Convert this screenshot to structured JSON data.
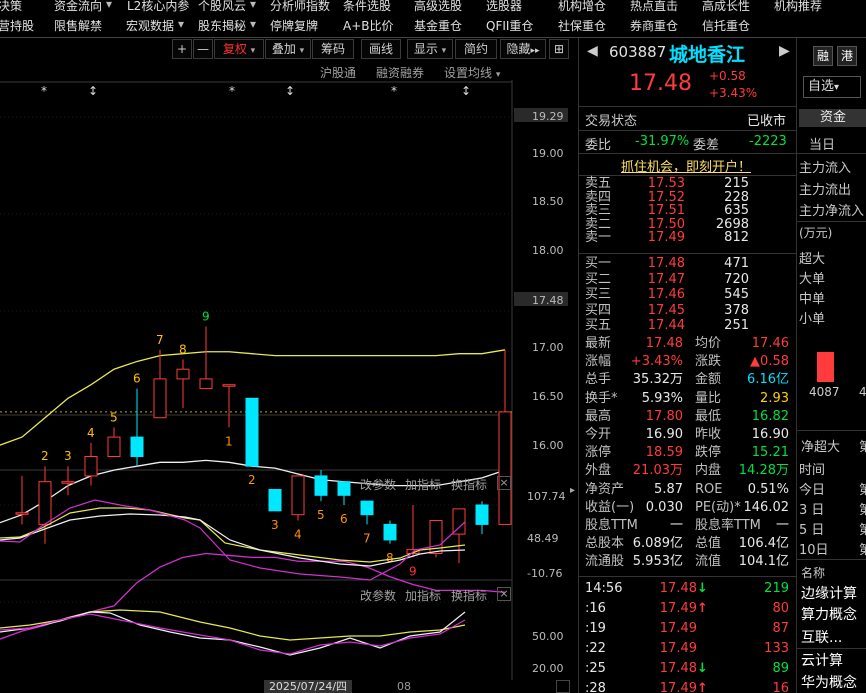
{
  "topnav": {
    "row1": [
      "决策",
      "资金流向",
      "L2核心内参",
      "个股风云",
      "分析师指数",
      "条件选股",
      "高级选股",
      "选股器",
      "机构增仓",
      "热点直击",
      "高成长性",
      "机构推荐"
    ],
    "row2": [
      "营持股",
      "限售解禁",
      "宏观数据",
      "股东揭秘",
      "停牌复牌",
      "A+B比价",
      "基金重仓",
      "QFII重仓",
      "社保重仓",
      "券商重仓",
      "信托重仓"
    ],
    "row1_arrows": [
      "▾",
      "▾"
    ],
    "row2_arrows": [
      "▾",
      "▾"
    ]
  },
  "toolbar": {
    "plus": "+",
    "minus": "—",
    "fuquan": "复权",
    "diejia": "叠加",
    "chouma": "筹码",
    "huaxian": "画线",
    "xianshi": "显示",
    "jianyue": "简约",
    "yincang": "隐藏",
    "yincang_arrows": "▸▸",
    "split": "⊞",
    "dropdown_arrow": "▾"
  },
  "subbar": {
    "hgt": "沪股通",
    "rzrq": "融资融券",
    "settings": "设置均线",
    "settings_arrow": "▾"
  },
  "indicator_bar": {
    "gai": "改参数",
    "jia": "加指标",
    "huan": "换指标",
    "close": "×"
  },
  "chart_data": [
    {
      "type": "candlestick",
      "yaxis_ticks": [
        "19.29",
        "19.00",
        "18.50",
        "18.00",
        "17.48",
        "17.00",
        "16.50",
        "16.00"
      ],
      "current_price_line": 17.48,
      "candles": [
        {
          "o": 16.96,
          "c": 16.96,
          "h": 17.15,
          "l": 16.9
        },
        {
          "o": 16.9,
          "c": 17.12,
          "h": 17.2,
          "l": 16.8
        },
        {
          "o": 17.12,
          "c": 17.12,
          "h": 17.2,
          "l": 17.05
        },
        {
          "o": 17.15,
          "c": 17.25,
          "h": 17.32,
          "l": 17.1
        },
        {
          "o": 17.25,
          "c": 17.35,
          "h": 17.4,
          "l": 17.3
        },
        {
          "o": 17.35,
          "c": 17.25,
          "h": 17.6,
          "l": 17.2
        },
        {
          "o": 17.45,
          "c": 17.65,
          "h": 17.8,
          "l": 17.45
        },
        {
          "o": 17.65,
          "c": 17.7,
          "h": 17.75,
          "l": 17.5
        },
        {
          "o": 17.6,
          "c": 17.65,
          "h": 17.92,
          "l": 17.6
        },
        {
          "o": 17.62,
          "c": 17.62,
          "h": 17.62,
          "l": 17.4
        },
        {
          "o": 17.55,
          "c": 17.2,
          "h": 17.55,
          "l": 17.2
        },
        {
          "o": 17.08,
          "c": 16.97,
          "h": 17.08,
          "l": 16.97
        },
        {
          "o": 16.95,
          "c": 17.15,
          "h": 17.15,
          "l": 16.92
        },
        {
          "o": 17.15,
          "c": 17.05,
          "h": 17.18,
          "l": 17.02
        },
        {
          "o": 17.12,
          "c": 17.05,
          "h": 17.12,
          "l": 17.0
        },
        {
          "o": 17.02,
          "c": 16.95,
          "h": 17.02,
          "l": 16.9
        },
        {
          "o": 16.9,
          "c": 16.82,
          "h": 16.92,
          "l": 16.8
        },
        {
          "o": 16.75,
          "c": 16.77,
          "h": 17.0,
          "l": 16.73
        },
        {
          "o": 16.75,
          "c": 16.92,
          "h": 16.92,
          "l": 16.73
        },
        {
          "o": 16.85,
          "c": 16.98,
          "h": 16.98,
          "l": 16.7
        },
        {
          "o": 17.0,
          "c": 16.9,
          "h": 17.02,
          "l": 16.85
        },
        {
          "o": 16.9,
          "c": 17.48,
          "h": 17.8,
          "l": 16.9
        }
      ],
      "ma_upper": [
        17.35,
        17.45,
        17.55,
        17.62,
        17.7,
        17.74,
        17.77,
        17.78,
        17.79,
        17.79,
        17.78,
        17.77,
        17.77,
        17.77,
        17.77,
        17.77,
        17.77,
        17.77,
        17.77,
        17.78,
        17.78,
        17.8
      ],
      "ma_mid": [
        16.95,
        17.02,
        17.1,
        17.15,
        17.18,
        17.2,
        17.22,
        17.22,
        17.23,
        17.22,
        17.2,
        17.19,
        17.16,
        17.13,
        17.12,
        17.11,
        17.1,
        17.1,
        17.1,
        17.12,
        17.14,
        17.18
      ],
      "ma_lower": [
        16.35,
        16.38,
        16.42,
        16.45,
        16.48,
        16.6,
        16.68,
        16.73,
        16.75,
        16.74,
        16.73,
        16.73,
        16.71,
        16.71,
        16.71,
        16.68,
        16.63,
        16.59,
        16.56,
        16.56,
        16.56,
        16.55
      ],
      "td_labels_up": [
        "2",
        "3",
        "4",
        "5",
        "6",
        "7",
        "8",
        "9"
      ],
      "td_labels_down": [
        "1",
        "2",
        "3",
        "4",
        "5",
        "6",
        "7",
        "8",
        "9"
      ]
    },
    {
      "type": "line",
      "yaxis_ticks": [
        "107.74",
        "48.49",
        "-10.76"
      ]
    },
    {
      "type": "line",
      "yaxis_ticks": [
        "50.00",
        "20.00"
      ]
    }
  ],
  "date_label": "2025/07/24/四",
  "date_label2": "08",
  "panel": {
    "code": "603887",
    "name": "城地香江",
    "rong": "融",
    "gang": "港",
    "price": "17.48",
    "change": "+0.58",
    "change_pct": "+3.43%",
    "zixuan": "自选",
    "zixuan_arrow": "▾",
    "state_label": "交易状态",
    "state_value": "已收市",
    "weibi_label": "委比",
    "weibi_value": "-31.97%",
    "weicha_label": "委差",
    "weicha_value": "-2223",
    "promo": "抓住机会，即刻开户！",
    "asks": [
      {
        "label": "卖五",
        "price": "17.53",
        "vol": "215"
      },
      {
        "label": "卖四",
        "price": "17.52",
        "vol": "228"
      },
      {
        "label": "卖三",
        "price": "17.51",
        "vol": "635"
      },
      {
        "label": "卖二",
        "price": "17.50",
        "vol": "2698"
      },
      {
        "label": "卖一",
        "price": "17.49",
        "vol": "812"
      }
    ],
    "bids": [
      {
        "label": "买一",
        "price": "17.48",
        "vol": "471"
      },
      {
        "label": "买二",
        "price": "17.47",
        "vol": "720"
      },
      {
        "label": "买三",
        "price": "17.46",
        "vol": "545"
      },
      {
        "label": "买四",
        "price": "17.45",
        "vol": "378"
      },
      {
        "label": "买五",
        "price": "17.44",
        "vol": "251"
      }
    ],
    "stats": [
      {
        "l1": "最新",
        "v1": "17.48",
        "l2": "均价",
        "v2": "17.46"
      },
      {
        "l1": "涨幅",
        "v1": "+3.43%",
        "l2": "涨跌",
        "v2": "▲0.58"
      },
      {
        "l1": "总手",
        "v1": "35.32万",
        "l2": "金额",
        "v2": "6.16亿"
      },
      {
        "l1": "换手*",
        "v1": "5.93%",
        "l2": "量比",
        "v2": "2.93"
      },
      {
        "l1": "最高",
        "v1": "17.80",
        "l2": "最低",
        "v2": "16.82"
      },
      {
        "l1": "今开",
        "v1": "16.90",
        "l2": "昨收",
        "v2": "16.90"
      },
      {
        "l1": "涨停",
        "v1": "18.59",
        "l2": "跌停",
        "v2": "15.21"
      },
      {
        "l1": "外盘",
        "v1": "21.03万",
        "l2": "内盘",
        "v2": "14.28万"
      },
      {
        "l1": "净资产",
        "v1": "5.87",
        "l2": "ROE",
        "v2": "0.51%"
      },
      {
        "l1": "收益(一)",
        "v1": "0.030",
        "l2": "PE(动)*",
        "v2": "146.02"
      },
      {
        "l1": "股息TTM",
        "v1": "一",
        "l2": "股息率TTM",
        "v2": "一"
      },
      {
        "l1": "总股本",
        "v1": "6.089亿",
        "l2": "总值",
        "v2": "106.4亿"
      },
      {
        "l1": "流通股",
        "v1": "5.953亿",
        "l2": "流值",
        "v2": "104.1亿"
      }
    ],
    "ticks": [
      {
        "time": "14:56",
        "price": "17.48",
        "dir": "↓",
        "vol": "219"
      },
      {
        "time": ":16",
        "price": "17.49",
        "dir": "↑",
        "vol": "80"
      },
      {
        "time": ":19",
        "price": "17.49",
        "dir": "",
        "vol": "87"
      },
      {
        "time": ":22",
        "price": "17.49",
        "dir": "",
        "vol": "133"
      },
      {
        "time": ":25",
        "price": "17.48",
        "dir": "↓",
        "vol": "89"
      },
      {
        "time": ":28",
        "price": "17.49",
        "dir": "↑",
        "vol": "16"
      }
    ]
  },
  "far_panel": {
    "zijin": "资金",
    "dangri": "当日",
    "items": [
      "主力流入",
      "主力流出",
      "主力净流入"
    ],
    "unit": "(万元)",
    "sizes": [
      "超大",
      "大单",
      "中单",
      "小单"
    ],
    "bar_value": "4087",
    "bar_value2": "4",
    "jingchaoda": "净超大",
    "shijian": "时间",
    "days": [
      "今日",
      "3 日",
      "5 日",
      "10日"
    ],
    "di": "第",
    "mingcheng": "名称",
    "concepts": [
      "边缘计算",
      "算力概念",
      "互联...",
      "云计算",
      "华为概念"
    ]
  }
}
